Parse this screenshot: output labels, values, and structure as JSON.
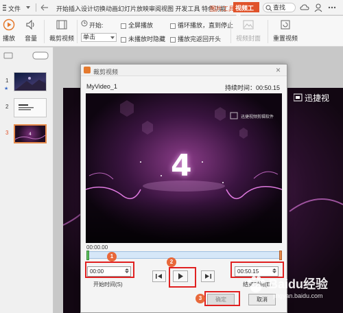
{
  "menubar": {
    "file_label": "文件",
    "menus": "开始插入设计切换动画幻灯片放映审阅视图 开发工具 特色功能",
    "picture_tools": "图片工具",
    "playback_tools": "视频工具",
    "search_label": "查找"
  },
  "ribbon": {
    "play": "播放",
    "volume": "音量",
    "trim_video": "裁剪视频",
    "start_label": "开始:",
    "start_value": "单击",
    "fullscreen": "全屏播放",
    "hide_when_not_playing": "未播放时隐藏",
    "loop_until_stopped": "循环播放，直到停止",
    "rewind_after_playing": "播放完返回开头",
    "video_cover": "视频封面",
    "reset_video": "重置视频"
  },
  "thumbs": [
    {
      "num": "1",
      "star": "★"
    },
    {
      "num": "2"
    },
    {
      "num": "3"
    }
  ],
  "slide": {
    "brand": "迅捷视"
  },
  "dialog": {
    "title": "裁剪视频",
    "close": "×",
    "video_name": "MyVideo_1",
    "duration": "持续时间：00:50.15",
    "video_overlay_logo": "迅捷视频剪辑软件",
    "video_number": "4",
    "time_zero": "00:00.00",
    "start_time_value": "00:00",
    "start_time_label": "开始时间(S)",
    "end_time_value": "00:50.15",
    "end_time_label": "结束时间(E)",
    "ok": "确定",
    "cancel": "取消"
  },
  "annotations": [
    "1",
    "2",
    "3"
  ],
  "watermark": {
    "text": "Baidu经验",
    "url": "jingyan.baidu.com"
  },
  "colors": {
    "accent": "#e0522a",
    "annotation_red": "#e02020",
    "badge": "#e8683a",
    "slide_bg": "#1c0f1f",
    "video_purple": "#6b2a6a"
  }
}
